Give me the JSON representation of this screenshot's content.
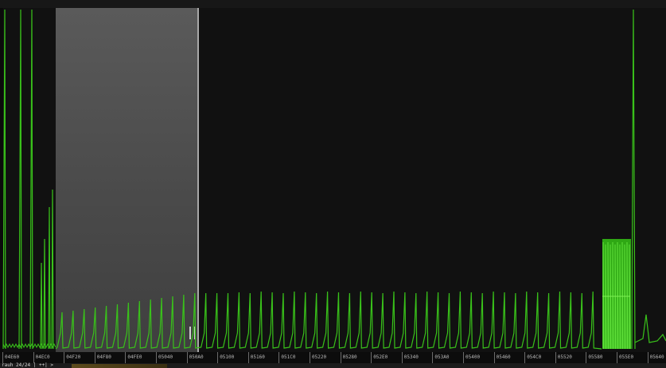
{
  "colors": {
    "background": "#111111",
    "selection": "#4d4d4d",
    "trace": "#39c21a",
    "trace_fill": "#2fa814",
    "axis_text": "#b8b8b8"
  },
  "axis": {
    "labels": [
      "04E60",
      "04EC0",
      "04F20",
      "04F80",
      "04FE0",
      "05040",
      "050A0",
      "05100",
      "05160",
      "051C0",
      "05220",
      "05280",
      "052E0",
      "05340",
      "053A0",
      "05400",
      "05460",
      "054C0",
      "05520",
      "05580",
      "055E0",
      "05640"
    ]
  },
  "status": {
    "text": "rauh 24/24 | ++| >"
  }
}
